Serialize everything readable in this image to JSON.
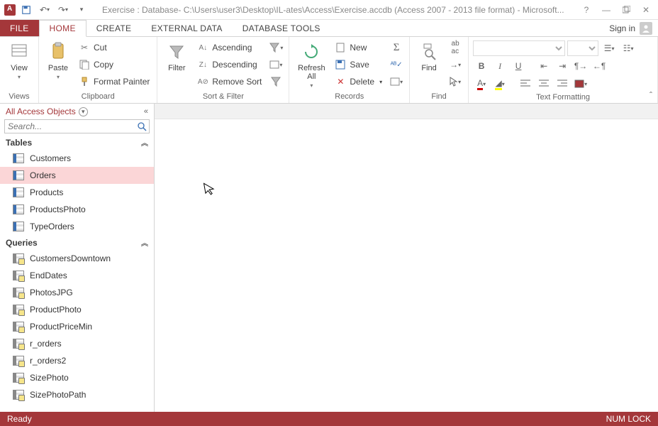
{
  "title": "Exercise : Database- C:\\Users\\user3\\Desktop\\IL-ates\\Access\\Exercise.accdb (Access 2007 - 2013 file format) - Microsoft...",
  "signin_label": "Sign in",
  "tabs": {
    "file": "FILE",
    "home": "HOME",
    "create": "CREATE",
    "external": "EXTERNAL DATA",
    "dbtools": "DATABASE TOOLS"
  },
  "ribbon": {
    "views": {
      "view": "View",
      "group": "Views"
    },
    "clipboard": {
      "paste": "Paste",
      "cut": "Cut",
      "copy": "Copy",
      "fp": "Format Painter",
      "group": "Clipboard"
    },
    "sortfilter": {
      "filter": "Filter",
      "asc": "Ascending",
      "desc": "Descending",
      "remove": "Remove Sort",
      "group": "Sort & Filter"
    },
    "records": {
      "refresh": "Refresh All",
      "new": "New",
      "save": "Save",
      "delete": "Delete",
      "group": "Records"
    },
    "find": {
      "find": "Find",
      "group": "Find"
    },
    "textfmt": {
      "group": "Text Formatting"
    }
  },
  "nav": {
    "title": "All Access Objects",
    "search_placeholder": "Search...",
    "sections": {
      "tables": "Tables",
      "queries": "Queries"
    },
    "tables": [
      "Customers",
      "Orders",
      "Products",
      "ProductsPhoto",
      "TypeOrders"
    ],
    "selected_table": "Orders",
    "queries": [
      "CustomersDowntown",
      "EndDates",
      "PhotosJPG",
      "ProductPhoto",
      "ProductPriceMin",
      "r_orders",
      "r_orders2",
      "SizePhoto",
      "SizePhotoPath"
    ]
  },
  "status": {
    "left": "Ready",
    "right": "NUM LOCK"
  }
}
